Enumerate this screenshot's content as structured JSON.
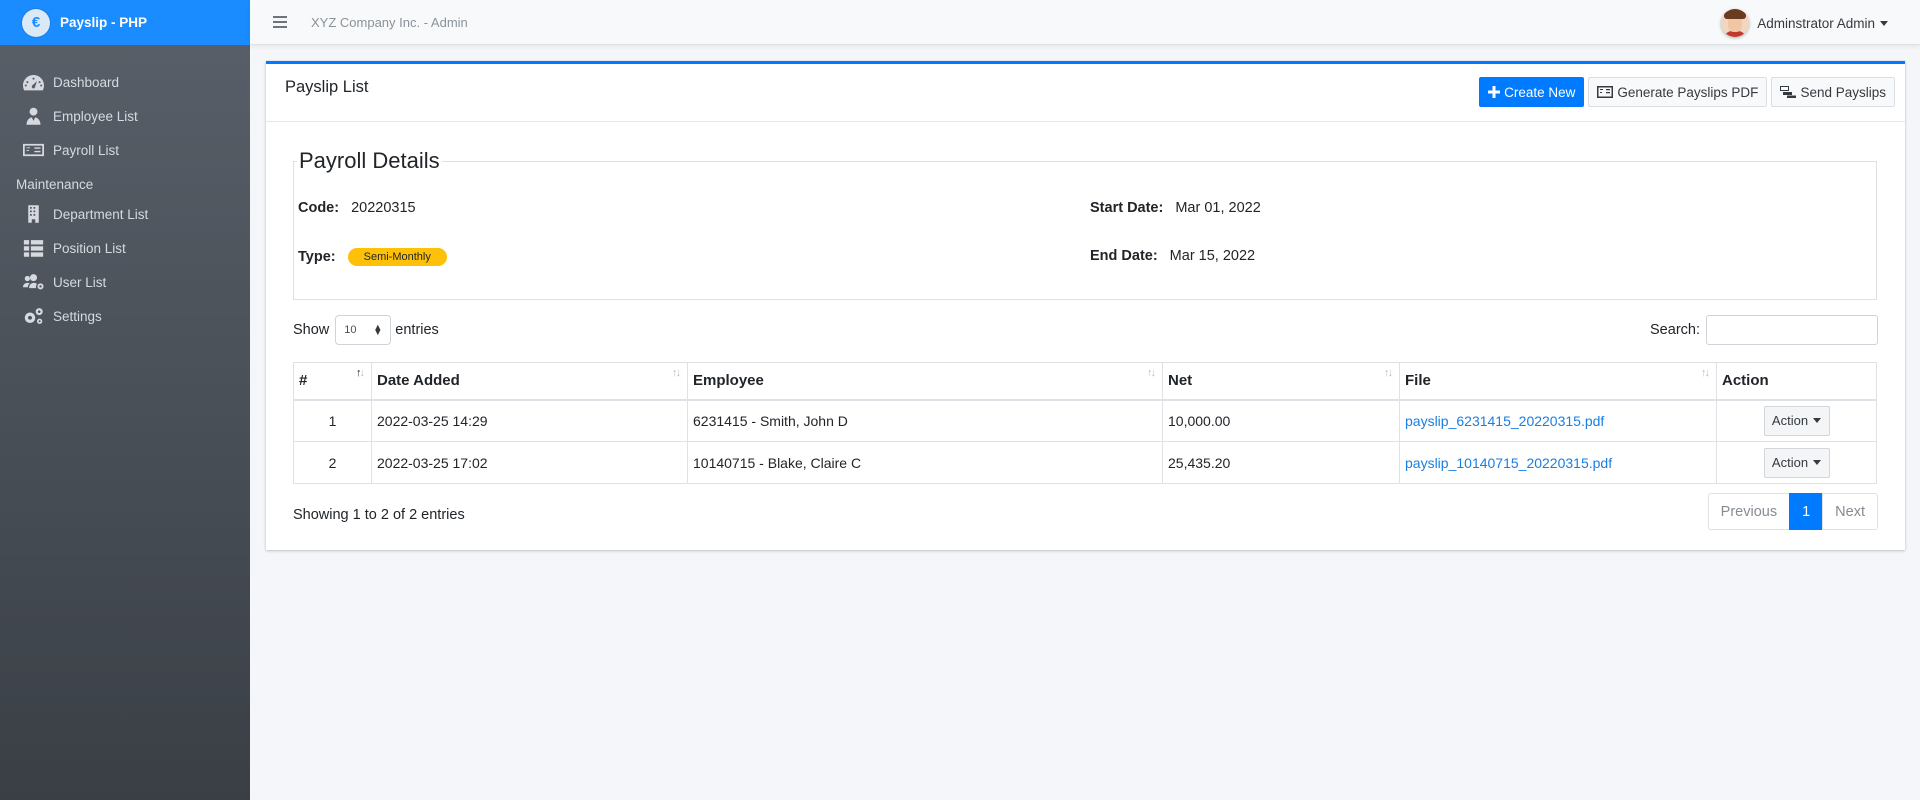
{
  "brand": {
    "name": "Payslip - PHP",
    "logo_letter": "€"
  },
  "sidebar": {
    "items": [
      {
        "label": "Dashboard",
        "icon": "tachometer-icon"
      },
      {
        "label": "Employee List",
        "icon": "user-tie-icon"
      },
      {
        "label": "Payroll List",
        "icon": "money-bill-icon"
      }
    ],
    "maintenance_header": "Maintenance",
    "maintenance_items": [
      {
        "label": "Department List",
        "icon": "building-icon"
      },
      {
        "label": "Position List",
        "icon": "th-list-icon"
      },
      {
        "label": "User List",
        "icon": "users-cog-icon"
      },
      {
        "label": "Settings",
        "icon": "cogs-icon"
      }
    ]
  },
  "topbar": {
    "company": "XYZ Company Inc. - Admin",
    "user_name": "Adminstrator Admin"
  },
  "card": {
    "title": "Payslip List",
    "buttons": {
      "create": "Create New",
      "generate": "Generate Payslips PDF",
      "send": "Send Payslips"
    }
  },
  "payroll": {
    "legend": "Payroll Details",
    "code_label": "Code:",
    "code_value": "20220315",
    "type_label": "Type:",
    "type_value": "Semi-Monthly",
    "start_label": "Start Date:",
    "start_value": "Mar 01, 2022",
    "end_label": "End Date:",
    "end_value": "Mar 15, 2022"
  },
  "table_controls": {
    "show": "Show",
    "length_value": "10",
    "entries": "entries",
    "search_label": "Search:",
    "search_value": ""
  },
  "table": {
    "headers": [
      "#",
      "Date Added",
      "Employee",
      "Net",
      "File",
      "Action"
    ],
    "rows": [
      {
        "num": "1",
        "date": "2022-03-25 14:29",
        "employee": "6231415 - Smith, John D",
        "net": "10,000.00",
        "file": "payslip_6231415_20220315.pdf",
        "action": "Action"
      },
      {
        "num": "2",
        "date": "2022-03-25 17:02",
        "employee": "10140715 - Blake, Claire C",
        "net": "25,435.20",
        "file": "payslip_10140715_20220315.pdf",
        "action": "Action"
      }
    ]
  },
  "footer": {
    "info": "Showing 1 to 2 of 2 entries",
    "previous": "Previous",
    "page": "1",
    "next": "Next"
  },
  "colors": {
    "primary": "#007bff",
    "brand_bar": "#1a8cff",
    "badge": "#ffc107"
  }
}
